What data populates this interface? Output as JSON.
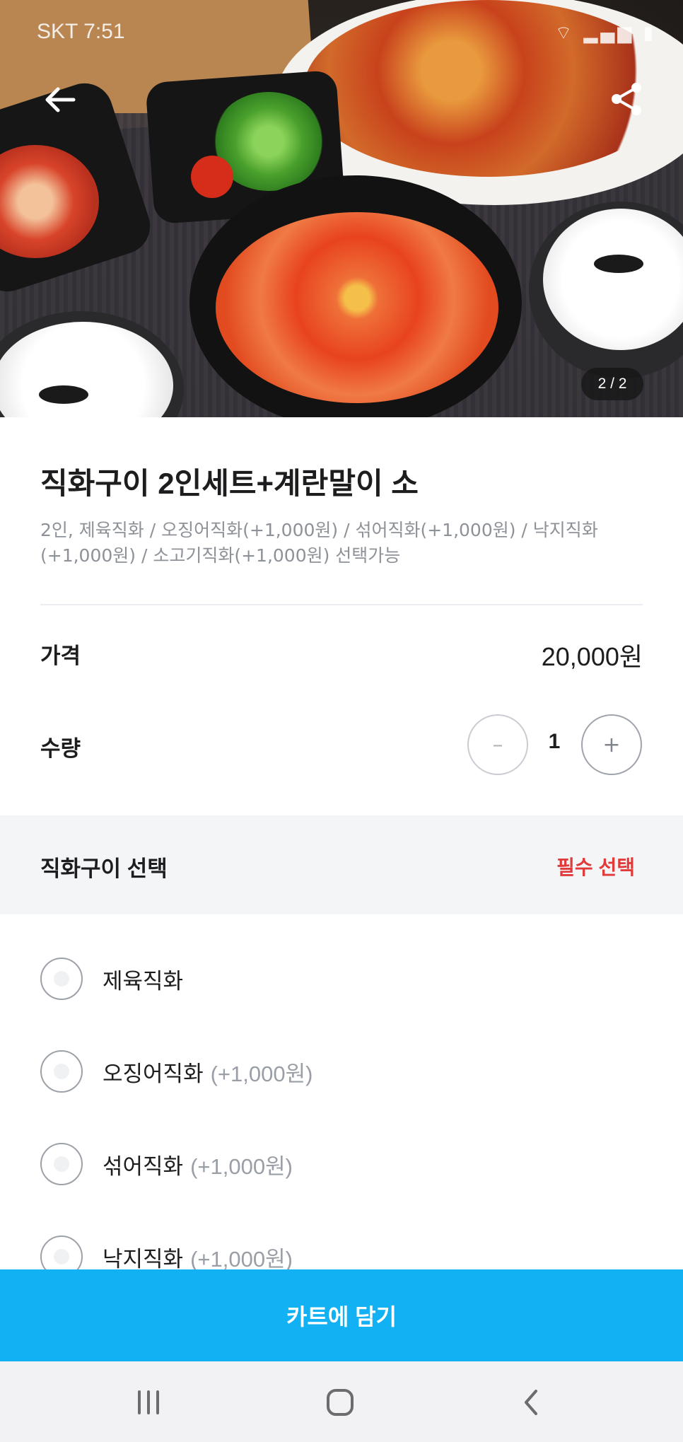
{
  "status_bar": {
    "time": "SKT 7:51",
    "indicators": "⌔ ▂▄▆ ▮"
  },
  "hero": {
    "image_counter": "2 / 2"
  },
  "product": {
    "name": "직화구이 2인세트+계란말이 소",
    "description": "2인, 제육직화 / 오징어직화(+1,000원) / 섞어직화(+1,000원) / 낙지직화(+1,000원) / 소고기직화(+1,000원) 선택가능"
  },
  "price": {
    "label": "가격",
    "value": "20,000원"
  },
  "quantity": {
    "label": "수량",
    "value": "1",
    "minus": "–",
    "plus": "+"
  },
  "option_group": {
    "title": "직화구이 선택",
    "required_badge": "필수 선택",
    "options": [
      {
        "label": "제육직화",
        "extra": ""
      },
      {
        "label": "오징어직화",
        "extra": "(+1,000원)"
      },
      {
        "label": "섞어직화",
        "extra": "(+1,000원)"
      },
      {
        "label": "낙지직화",
        "extra": "(+1,000원)"
      }
    ]
  },
  "cart_button": {
    "label": "카트에 담기"
  },
  "colors": {
    "accent": "#12b1f4",
    "required": "#e03a3a"
  },
  "icons": {
    "back": "arrow-left-icon",
    "share": "share-icon",
    "nav_recent": "recent-apps-icon",
    "nav_home": "home-icon",
    "nav_back": "chevron-left-icon"
  }
}
